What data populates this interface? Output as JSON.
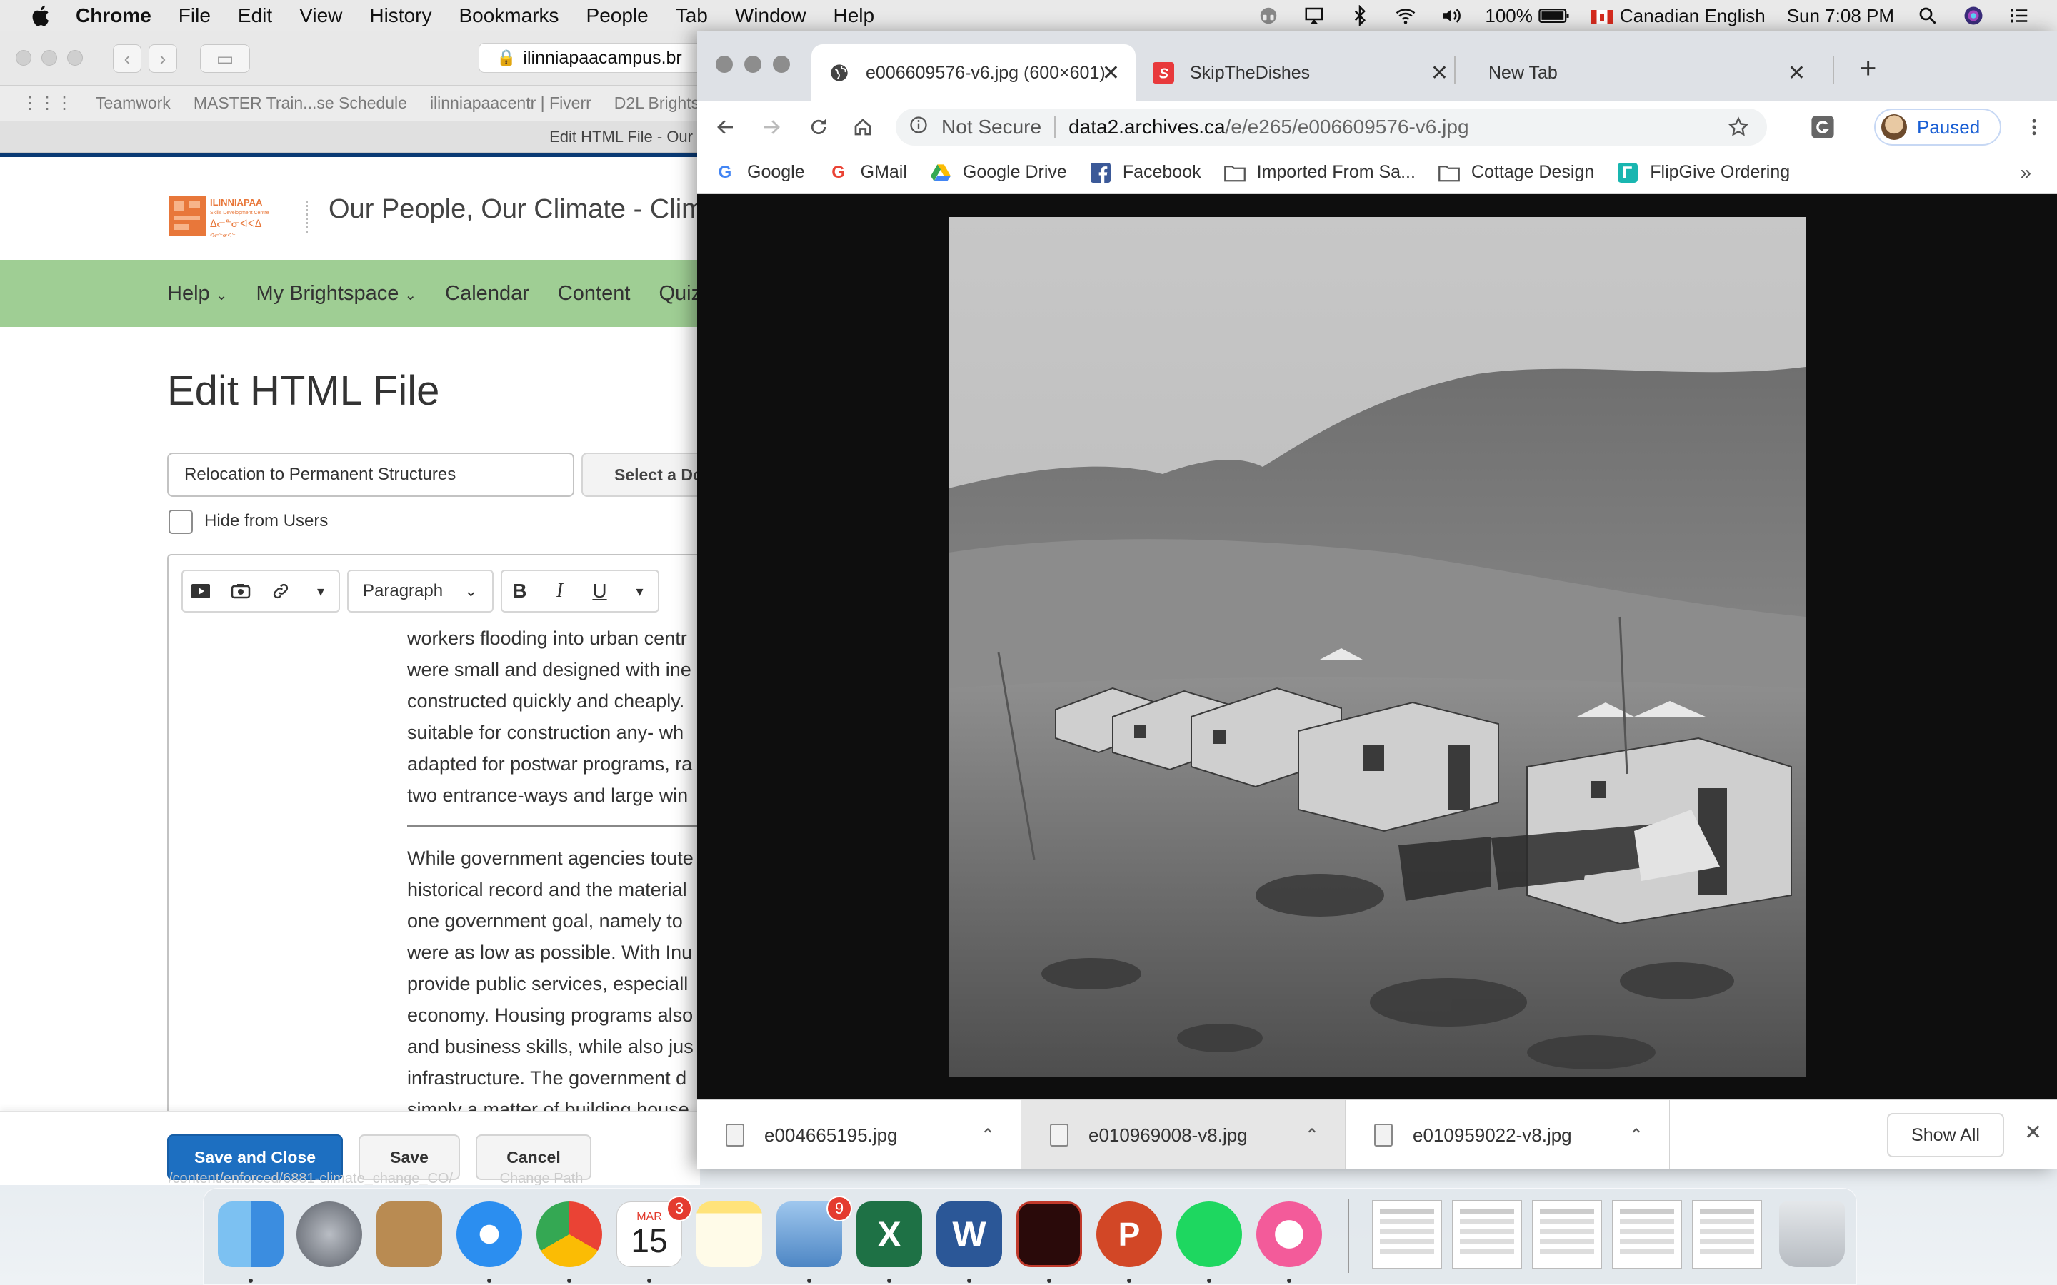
{
  "menubar": {
    "app": "Chrome",
    "items": [
      "File",
      "Edit",
      "View",
      "History",
      "Bookmarks",
      "People",
      "Tab",
      "Window",
      "Help"
    ],
    "battery": "100%",
    "input_source": "Canadian English",
    "clock": "Sun 7:08 PM"
  },
  "back_window": {
    "url": "ilinniapaacampus.br",
    "bookmarks": [
      "Teamwork",
      "MASTER Train...se Schedule",
      "ilinniapaacentr | Fiverr",
      "D2L Brightspace"
    ],
    "tab_title": "Edit HTML File - Our",
    "site_title": "Our People, Our Climate - Clim",
    "nav": [
      "Help",
      "My Brightspace",
      "Calendar",
      "Content",
      "Quiz"
    ],
    "page_heading": "Edit HTML File",
    "title_value": "Relocation to Permanent Structures",
    "select_button": "Select a Do",
    "hide_label": "Hide from Users",
    "format_select": "Paragraph",
    "body_lines_1": [
      "workers flooding into urban centr",
      "were small and designed with ine",
      "constructed quickly and cheaply.",
      "suitable for construction any- wh",
      "adapted for postwar programs, ra",
      "two entrance-ways and large win"
    ],
    "body_lines_2": [
      "While government agencies toute",
      "historical record and the material",
      "one government goal, namely to",
      "were as low as possible. With Inu",
      "provide public services, especiall",
      "economy. Housing programs also",
      "and business skills, while also jus",
      "infrastructure. The government d"
    ],
    "body_last_line": "simply a matter of building house",
    "buttons": {
      "save_close": "Save and Close",
      "save": "Save",
      "cancel": "Cancel"
    },
    "path_text": "/content/enforced/6881-climate_change_CO/",
    "path_link": "Change Path"
  },
  "chrome": {
    "tabs": [
      {
        "title": "e006609576-v6.jpg (600×601)"
      },
      {
        "title": "SkipTheDishes"
      },
      {
        "title": "New Tab"
      }
    ],
    "omnibox": {
      "security": "Not Secure",
      "domain": "data2.archives.ca",
      "path": "/e/e265/e006609576-v6.jpg"
    },
    "profile": "Paused",
    "bookmarks": [
      {
        "label": "Google",
        "icon": "google-icon"
      },
      {
        "label": "GMail",
        "icon": "google-icon"
      },
      {
        "label": "Google Drive",
        "icon": "drive-icon"
      },
      {
        "label": "Facebook",
        "icon": "facebook-icon"
      },
      {
        "label": "Imported From Sa...",
        "icon": "folder-icon"
      },
      {
        "label": "Cottage Design",
        "icon": "folder-icon"
      },
      {
        "label": "FlipGive Ordering",
        "icon": "flipgive-icon"
      }
    ],
    "more": "»",
    "downloads": [
      "e004665195.jpg",
      "e010969008-v8.jpg",
      "e010959022-v8.jpg"
    ],
    "show_all": "Show All"
  },
  "dock": {
    "calendar_month": "MAR",
    "calendar_day": "15",
    "calendar_badge": "3",
    "mail_badge": "9"
  }
}
